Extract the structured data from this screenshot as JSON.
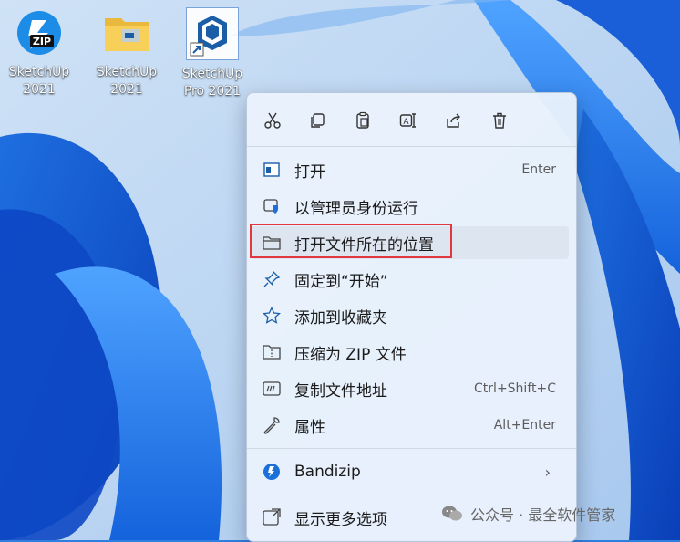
{
  "desktop": {
    "icons": [
      {
        "label_line1": "SketchUp",
        "label_line2": "2021",
        "icon": "zip-archive-icon"
      },
      {
        "label_line1": "SketchUp",
        "label_line2": "2021",
        "icon": "folder-icon"
      },
      {
        "label_line1": "SketchUp",
        "label_line2": "Pro 2021",
        "icon": "sketchup-shortcut-icon"
      }
    ]
  },
  "context_menu": {
    "toolbar": [
      {
        "name": "cut",
        "icon": "scissors-icon"
      },
      {
        "name": "copy",
        "icon": "copy-icon"
      },
      {
        "name": "paste",
        "icon": "paste-icon"
      },
      {
        "name": "rename",
        "icon": "rename-icon"
      },
      {
        "name": "share",
        "icon": "share-icon"
      },
      {
        "name": "delete",
        "icon": "trash-icon"
      }
    ],
    "items": [
      {
        "label": "打开",
        "shortcut": "Enter",
        "icon": "open-window-icon"
      },
      {
        "label": "以管理员身份运行",
        "shortcut": "",
        "icon": "shield-icon"
      },
      {
        "label": "打开文件所在的位置",
        "shortcut": "",
        "icon": "folder-outline-icon"
      },
      {
        "label": "固定到“开始”",
        "shortcut": "",
        "icon": "pin-icon"
      },
      {
        "label": "添加到收藏夹",
        "shortcut": "",
        "icon": "star-icon"
      },
      {
        "label": "压缩为 ZIP 文件",
        "shortcut": "",
        "icon": "zip-folder-icon"
      },
      {
        "label": "复制文件地址",
        "shortcut": "Ctrl+Shift+C",
        "icon": "copy-path-icon"
      },
      {
        "label": "属性",
        "shortcut": "Alt+Enter",
        "icon": "wrench-icon"
      },
      {
        "label": "Bandizip",
        "shortcut": "",
        "icon": "bandizip-icon",
        "submenu": "›"
      },
      {
        "label": "显示更多选项",
        "shortcut": "",
        "icon": "more-options-icon"
      }
    ]
  },
  "watermark": {
    "text": "公众号 · 最全软件管家"
  },
  "colors": {
    "highlight_border": "#e0383e",
    "menu_bg": "#e9f1fc",
    "wallpaper": "#2f7fe0"
  }
}
